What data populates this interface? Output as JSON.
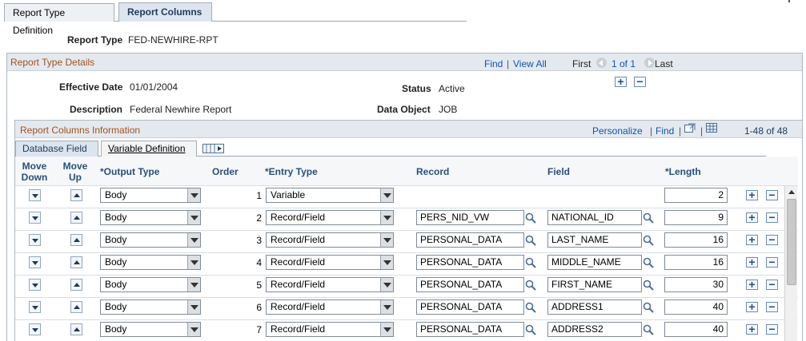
{
  "tabs": [
    {
      "label": "Report Type Definition",
      "active": false
    },
    {
      "label": "Report Columns",
      "active": true
    }
  ],
  "report_type": {
    "label": "Report Type",
    "value": "FED-NEWHIRE-RPT"
  },
  "details": {
    "title": "Report Type Details",
    "find": "Find",
    "sep": "|",
    "view_all": "View All",
    "first": "First",
    "page_info": "1 of 1",
    "last": "Last",
    "effective_date_label": "Effective Date",
    "effective_date": "01/01/2004",
    "status_label": "Status",
    "status": "Active",
    "description_label": "Description",
    "description": "Federal Newhire Report",
    "data_object_label": "Data Object",
    "data_object": "JOB",
    "add_symbol": "+",
    "remove_symbol": "−"
  },
  "grid": {
    "title": "Report Columns Information",
    "personalize": "Personalize",
    "find": "Find",
    "sep": "|",
    "count": "1-48 of 48",
    "tabs": [
      {
        "label": "Database Field",
        "active": true
      },
      {
        "label": "Variable Definition",
        "active": false
      }
    ],
    "headers": {
      "move_down": "Move Down",
      "move_up": "Move Up",
      "output_type": "*Output Type",
      "order": "Order",
      "entry_type": "*Entry Type",
      "record": "Record",
      "field": "Field",
      "length": "*Length"
    },
    "rows": [
      {
        "output_type": "Body",
        "order": "1",
        "entry_type": "Variable",
        "record": "",
        "field": "",
        "length": "2"
      },
      {
        "output_type": "Body",
        "order": "2",
        "entry_type": "Record/Field",
        "record": "PERS_NID_VW",
        "field": "NATIONAL_ID",
        "length": "9"
      },
      {
        "output_type": "Body",
        "order": "3",
        "entry_type": "Record/Field",
        "record": "PERSONAL_DATA",
        "field": "LAST_NAME",
        "length": "16"
      },
      {
        "output_type": "Body",
        "order": "4",
        "entry_type": "Record/Field",
        "record": "PERSONAL_DATA",
        "field": "MIDDLE_NAME",
        "length": "16"
      },
      {
        "output_type": "Body",
        "order": "5",
        "entry_type": "Record/Field",
        "record": "PERSONAL_DATA",
        "field": "FIRST_NAME",
        "length": "30"
      },
      {
        "output_type": "Body",
        "order": "6",
        "entry_type": "Record/Field",
        "record": "PERSONAL_DATA",
        "field": "ADDRESS1",
        "length": "40"
      },
      {
        "output_type": "Body",
        "order": "7",
        "entry_type": "Record/Field",
        "record": "PERSONAL_DATA",
        "field": "ADDRESS2",
        "length": "40"
      }
    ]
  },
  "colors": {
    "accent": "#1155aa",
    "section_title": "#a0521e",
    "header_text": "#2a4f7a"
  }
}
